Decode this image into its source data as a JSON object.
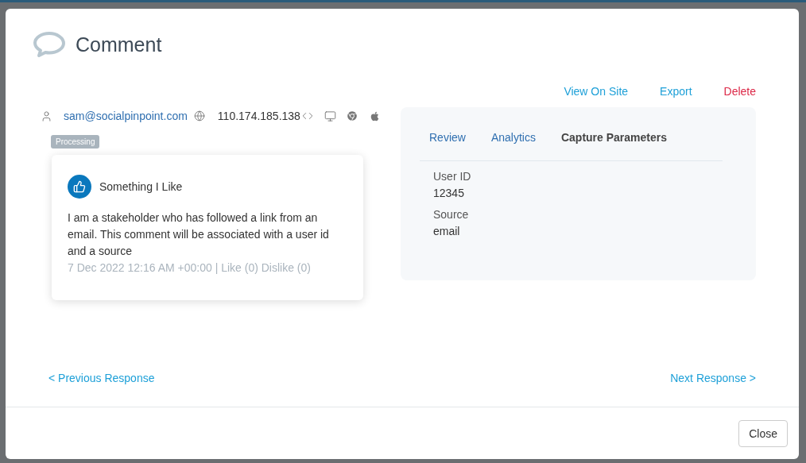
{
  "dialog": {
    "title": "Comment"
  },
  "actions": [
    {
      "label": "View On Site",
      "kind": "link"
    },
    {
      "label": "Export",
      "kind": "link"
    },
    {
      "label": "Delete",
      "kind": "danger"
    }
  ],
  "meta": {
    "email": "sam@socialpinpoint.com",
    "ip": "110.174.185.138",
    "status": "Processing"
  },
  "comment": {
    "title": "Something I Like",
    "body": "I am a stakeholder who has followed a link from an email. This comment will be associated with a user id and a source",
    "footer": "7 Dec 2022 12:16 AM +00:00 | Like (0) Dislike (0)"
  },
  "tabs": [
    {
      "label": "Review",
      "selected": false
    },
    {
      "label": "Analytics",
      "selected": false
    },
    {
      "label": "Capture Parameters",
      "selected": true
    }
  ],
  "parameters": [
    {
      "label": "User ID",
      "value": "12345"
    },
    {
      "label": "Source",
      "value": "email"
    }
  ],
  "navigation": {
    "previous": "< Previous Response",
    "next": "Next Response >"
  },
  "buttons": [
    "Close"
  ]
}
